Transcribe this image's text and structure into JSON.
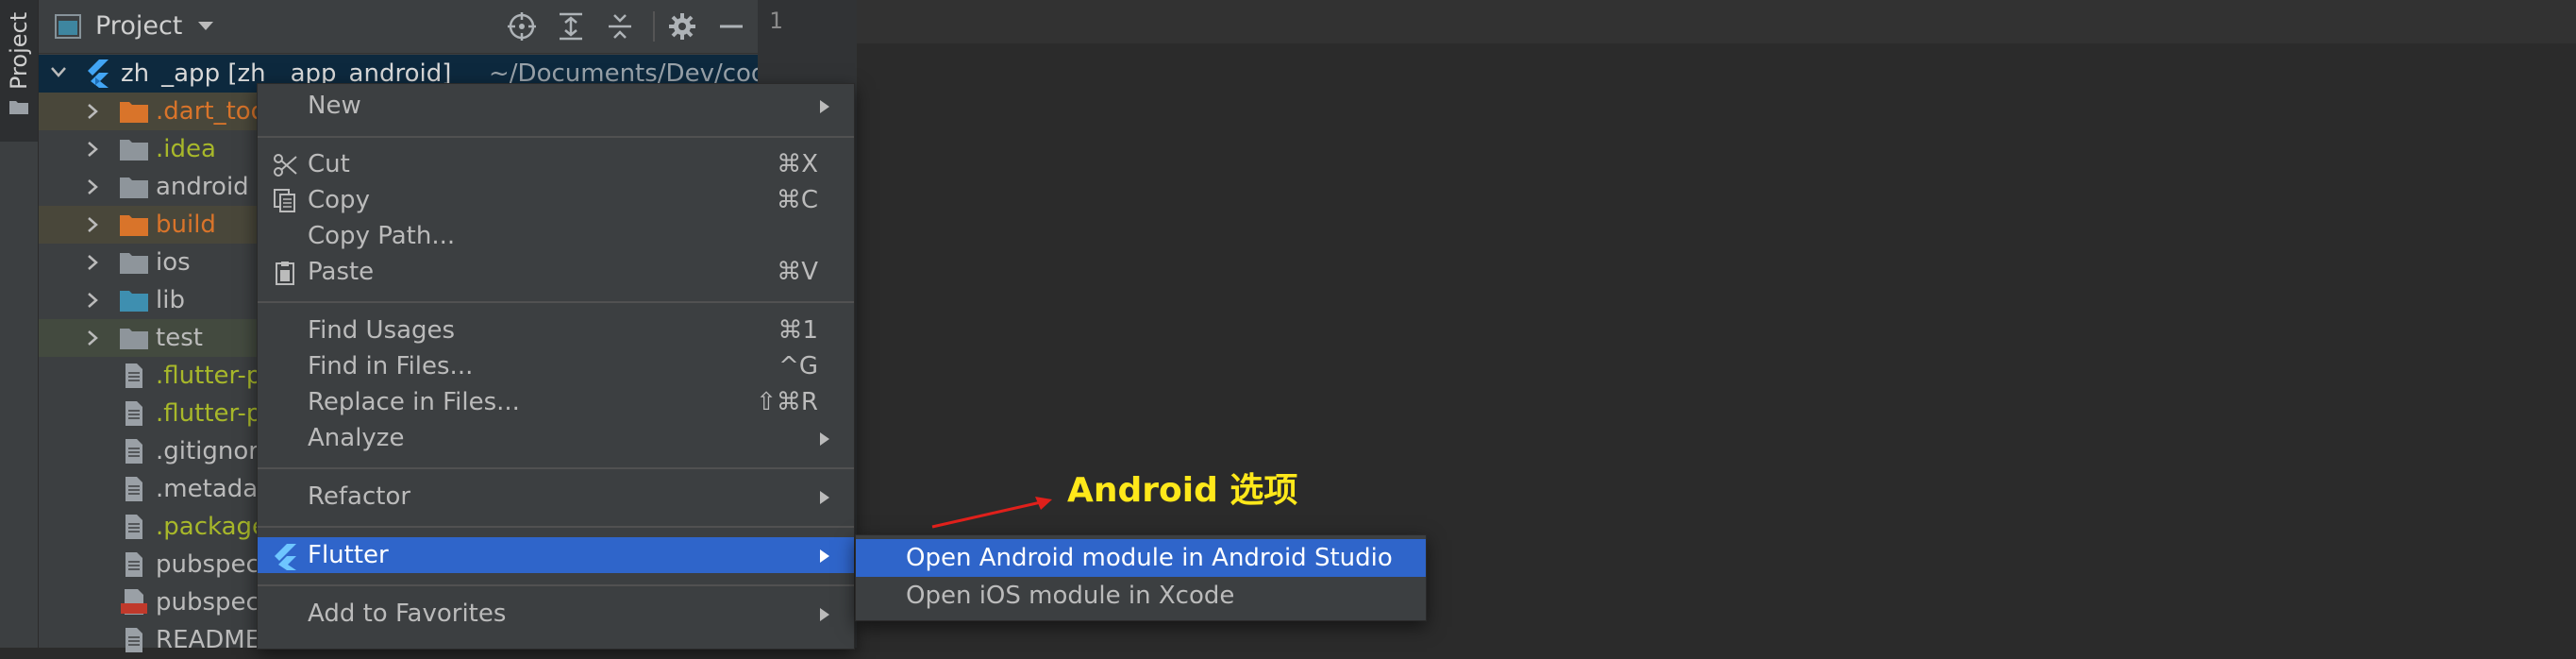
{
  "side_tab": {
    "label": "Project"
  },
  "project_panel": {
    "title": "Project",
    "root": {
      "name": "zh _app [zh  app_android]",
      "path": "~/Documents/Dev/cod"
    },
    "items": [
      {
        "label": ".dart_tool",
        "color": "#d9742a",
        "icon": "folder-icon",
        "expandable": true
      },
      {
        "label": ".idea",
        "color": "#a8b82a",
        "icon": "folder-icon",
        "expandable": true
      },
      {
        "label": "android",
        "color": "#bbbbbb",
        "icon": "folder-icon",
        "expandable": true
      },
      {
        "label": "build",
        "color": "#d9742a",
        "icon": "folder-icon",
        "expandable": true
      },
      {
        "label": "ios",
        "color": "#bbbbbb",
        "icon": "folder-icon",
        "expandable": true
      },
      {
        "label": "lib",
        "color": "#bbbbbb",
        "icon": "folder-icon",
        "expandable": true
      },
      {
        "label": "test",
        "color": "#bbbbbb",
        "icon": "folder-icon",
        "expandable": true
      },
      {
        "label": ".flutter-plugins",
        "color": "#a8b82a",
        "icon": "file-icon",
        "expandable": false
      },
      {
        "label": ".flutter-plugins-dependencies",
        "color": "#a8b82a",
        "icon": "file-icon",
        "expandable": false
      },
      {
        "label": ".gitignore",
        "color": "#bbbbbb",
        "icon": "file-icon",
        "expandable": false
      },
      {
        "label": ".metadata",
        "color": "#bbbbbb",
        "icon": "file-icon",
        "expandable": false
      },
      {
        "label": ".packages",
        "color": "#a8b82a",
        "icon": "file-icon",
        "expandable": false
      },
      {
        "label": "pubspec.lock",
        "color": "#bbbbbb",
        "icon": "file-icon",
        "expandable": false
      },
      {
        "label": "pubspec.yaml",
        "color": "#bbbbbb",
        "icon": "yaml-file-icon",
        "expandable": false
      },
      {
        "label": "README.md",
        "color": "#bbbbbb",
        "icon": "file-icon",
        "expandable": false
      }
    ]
  },
  "editor": {
    "line_number": "1"
  },
  "context_menu": {
    "new": {
      "label": "New"
    },
    "cut": {
      "label": "Cut",
      "shortcut": "⌘X"
    },
    "copy": {
      "label": "Copy",
      "shortcut": "⌘C"
    },
    "copy_path": {
      "label": "Copy Path..."
    },
    "paste": {
      "label": "Paste",
      "shortcut": "⌘V"
    },
    "find_usages": {
      "label": "Find Usages",
      "shortcut": "⌘1"
    },
    "find_in_files": {
      "label": "Find in Files...",
      "shortcut": "^G"
    },
    "replace_in_files": {
      "label": "Replace in Files...",
      "shortcut": "⇧⌘R"
    },
    "analyze": {
      "label": "Analyze"
    },
    "refactor": {
      "label": "Refactor"
    },
    "flutter": {
      "label": "Flutter"
    },
    "add_to_favorites": {
      "label": "Add to Favorites"
    }
  },
  "flutter_submenu": {
    "open_android": {
      "label": "Open Android module in Android Studio"
    },
    "open_ios": {
      "label": "Open iOS module in Xcode"
    }
  },
  "annotation": {
    "text": "Android 选项",
    "color": "#ffe81a"
  },
  "colors": {
    "highlight": "#2f65ca",
    "flutter_blue": "#42a5f5",
    "excluded_bg": "#49473a"
  }
}
